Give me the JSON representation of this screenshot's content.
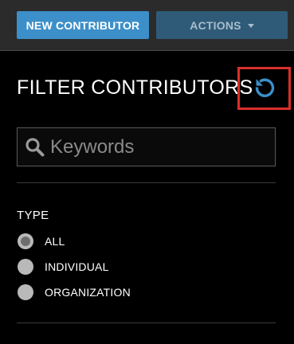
{
  "toolbar": {
    "new_contributor_label": "NEW CONTRIBUTOR",
    "actions_label": "ACTIONS",
    "actions_icon": "caret-down-icon"
  },
  "filter_panel": {
    "title": "FILTER CONTRIBUTORS",
    "reset_icon": "reset-icon",
    "search": {
      "icon": "search-icon",
      "placeholder": "Keywords",
      "value": ""
    },
    "type_section": {
      "title": "TYPE",
      "selected": "ALL",
      "options": [
        {
          "label": "ALL",
          "selected": true
        },
        {
          "label": "INDIVIDUAL",
          "selected": false
        },
        {
          "label": "ORGANIZATION",
          "selected": false
        }
      ]
    }
  },
  "colors": {
    "primary_button": "#3c8fc9",
    "secondary_button": "#2f5b79",
    "reset_icon": "#3c8fc9",
    "highlight_border": "#d9302c",
    "background": "#000000",
    "topbar": "#2b2b2b"
  }
}
